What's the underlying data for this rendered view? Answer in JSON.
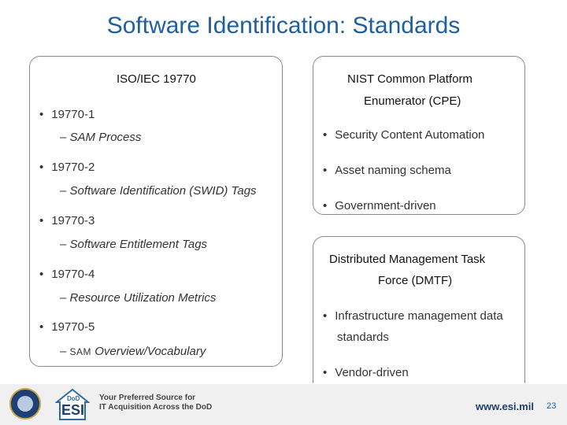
{
  "title": "Software Identification: Standards",
  "left_panel": {
    "heading": "ISO/IEC 19770",
    "items": [
      {
        "label": "19770-1",
        "sub": "SAM Process"
      },
      {
        "label": "19770-2",
        "sub": "Software Identification (SWID) Tags"
      },
      {
        "label": "19770-3",
        "sub": "Software Entitlement Tags"
      },
      {
        "label": "19770-4",
        "sub": "Resource Utilization Metrics"
      },
      {
        "label": "19770-5",
        "sub_prefix": "SAM",
        "sub_rest": " Overview/Vocabulary"
      }
    ]
  },
  "right_top": {
    "heading_line1": "NIST Common Platform",
    "heading_line2": "Enumerator (CPE)",
    "bullets": [
      "Security Content Automation",
      "Asset naming schema",
      "Government-driven"
    ]
  },
  "right_bottom": {
    "heading_line1": "Distributed Management Task",
    "heading_line2": "Force (DMTF)",
    "bullet1_line1": "Infrastructure management data",
    "bullet1_line2": "standards",
    "bullet2": "Vendor-driven"
  },
  "footer": {
    "logo_text": "ESI",
    "logo_badge": "DoD",
    "tagline_line1": "Your Preferred Source for",
    "tagline_line2": "IT Acquisition Across the DoD",
    "url": "www.esi.mil",
    "page_number": "23"
  },
  "symbols": {
    "bullet": "•",
    "dash": "–"
  },
  "colors": {
    "title": "#1f5f9e",
    "panel_border": "#8a8a8a",
    "footer_bg": "#f0f0f0",
    "seal": "#1d3f73"
  }
}
